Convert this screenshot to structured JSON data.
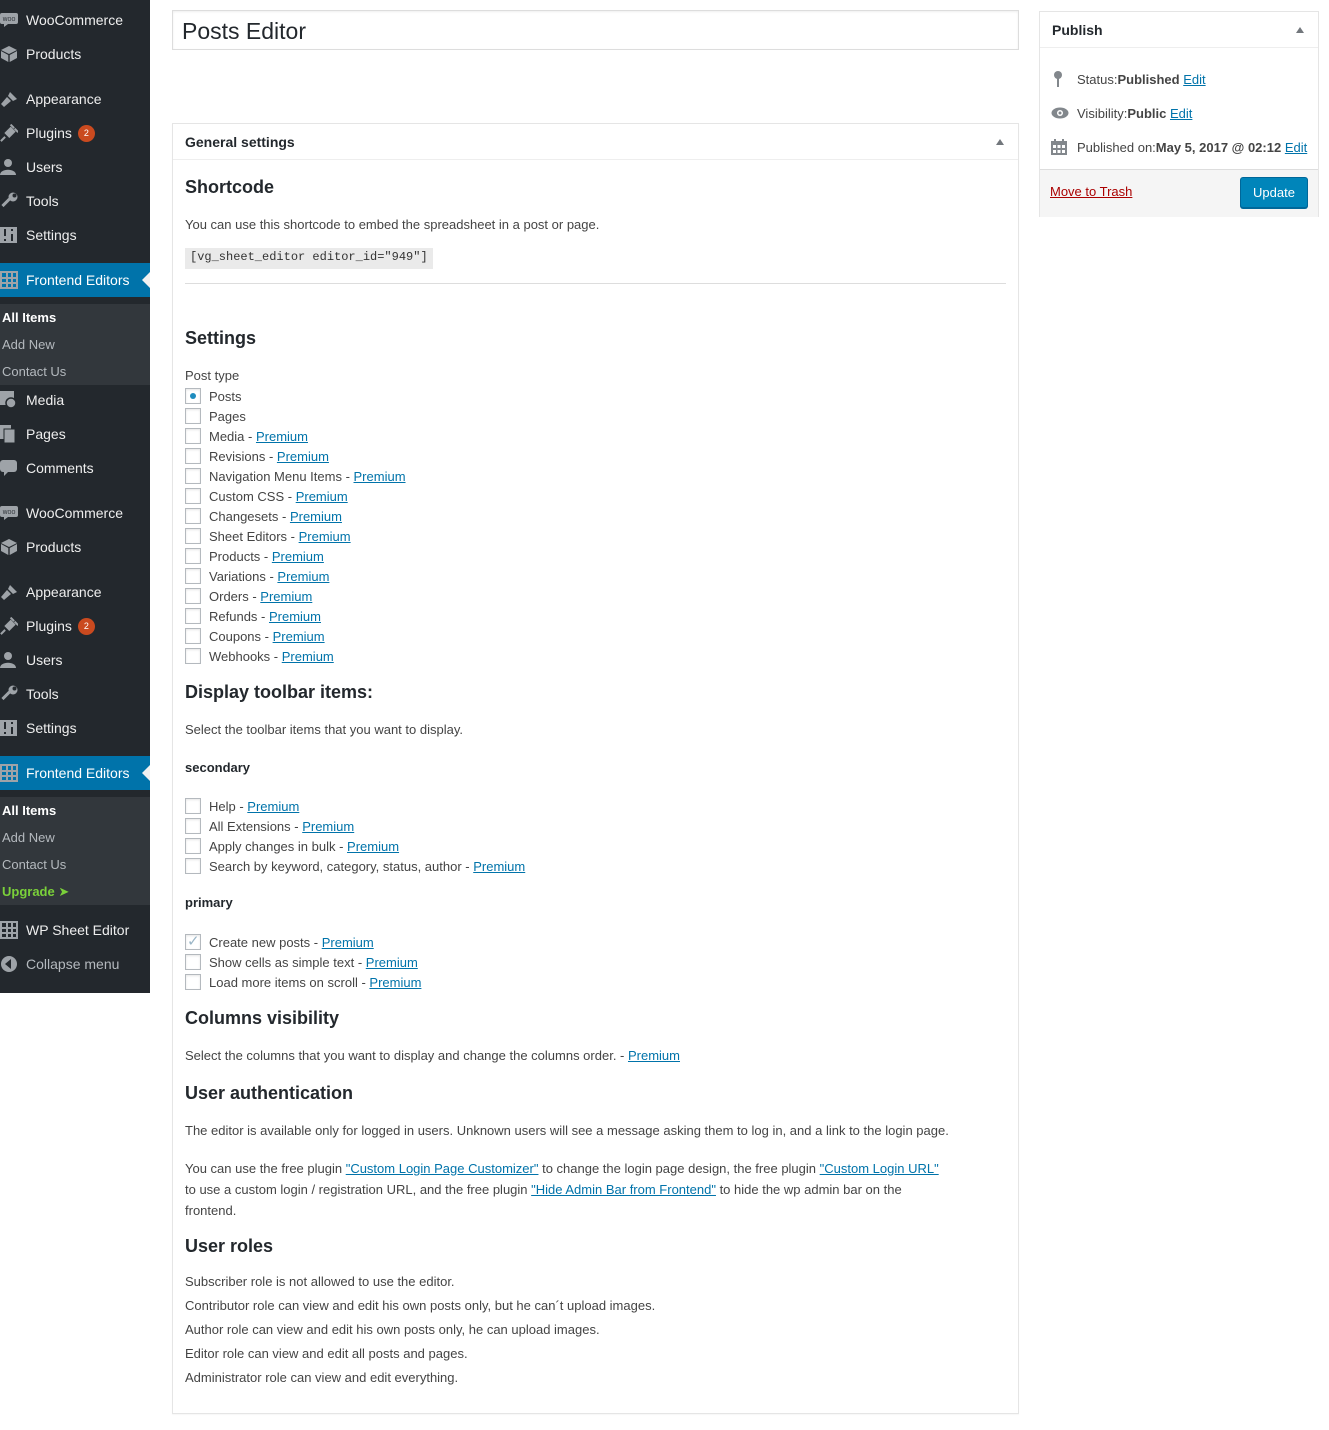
{
  "sidebar": {
    "group1": [
      {
        "label": "WooCommerce",
        "icon": "woo-icon"
      },
      {
        "label": "Products",
        "icon": "box-icon"
      },
      {
        "label": "Appearance",
        "icon": "paintbrush-icon"
      },
      {
        "label": "Plugins",
        "icon": "plugin-icon",
        "badge": "2"
      },
      {
        "label": "Users",
        "icon": "user-icon"
      },
      {
        "label": "Tools",
        "icon": "wrench-icon"
      },
      {
        "label": "Settings",
        "icon": "settings-icon"
      },
      {
        "label": "Frontend Editors",
        "icon": "grid-icon"
      }
    ],
    "submenu1": [
      "All Items",
      "Add New",
      "Contact Us"
    ],
    "group2": [
      {
        "label": "Media",
        "icon": "media-icon"
      },
      {
        "label": "Pages",
        "icon": "pages-icon"
      },
      {
        "label": "Comments",
        "icon": "comment-icon"
      },
      {
        "label": "WooCommerce",
        "icon": "woo-icon"
      },
      {
        "label": "Products",
        "icon": "box-icon"
      },
      {
        "label": "Appearance",
        "icon": "paintbrush-icon"
      },
      {
        "label": "Plugins",
        "icon": "plugin-icon",
        "badge": "2"
      },
      {
        "label": "Users",
        "icon": "user-icon"
      },
      {
        "label": "Tools",
        "icon": "wrench-icon"
      },
      {
        "label": "Settings",
        "icon": "settings-icon"
      },
      {
        "label": "Frontend Editors",
        "icon": "grid-icon"
      }
    ],
    "submenu2": [
      "All Items",
      "Add New",
      "Contact Us",
      "Upgrade ➤"
    ],
    "group3": [
      {
        "label": "WP Sheet Editor",
        "icon": "grid-icon"
      },
      {
        "label": "Collapse menu",
        "icon": "collapse-icon"
      }
    ]
  },
  "title": "Posts Editor",
  "general": {
    "header": "General settings",
    "shortcode_title": "Shortcode",
    "shortcode_desc": "You can use this shortcode to embed the spreadsheet in a post or page.",
    "shortcode_code": "[vg_sheet_editor editor_id=\"949\"]",
    "settings_title": "Settings",
    "post_type_label": "Post type",
    "post_types": [
      {
        "label": "Posts",
        "premium": ""
      },
      {
        "label": "Pages",
        "premium": ""
      },
      {
        "label": "Media - ",
        "premium": "Premium"
      },
      {
        "label": "Revisions - ",
        "premium": "Premium"
      },
      {
        "label": "Navigation Menu Items - ",
        "premium": "Premium"
      },
      {
        "label": "Custom CSS - ",
        "premium": "Premium"
      },
      {
        "label": "Changesets - ",
        "premium": "Premium"
      },
      {
        "label": "Sheet Editors - ",
        "premium": "Premium"
      },
      {
        "label": "Products - ",
        "premium": "Premium"
      },
      {
        "label": "Variations - ",
        "premium": "Premium"
      },
      {
        "label": "Orders - ",
        "premium": "Premium"
      },
      {
        "label": "Refunds - ",
        "premium": "Premium"
      },
      {
        "label": "Coupons - ",
        "premium": "Premium"
      },
      {
        "label": "Webhooks - ",
        "premium": "Premium"
      }
    ],
    "toolbar_title": "Display toolbar items:",
    "toolbar_desc": "Select the toolbar items that you want to display.",
    "secondary_label": "secondary",
    "secondary_items": [
      {
        "label": "Help - ",
        "premium": "Premium"
      },
      {
        "label": "All Extensions - ",
        "premium": "Premium"
      },
      {
        "label": "Apply changes in bulk - ",
        "premium": "Premium"
      },
      {
        "label": "Search by keyword, category, status, author - ",
        "premium": "Premium"
      }
    ],
    "primary_label": "primary",
    "primary_items": [
      {
        "label": "Create new posts - ",
        "premium": "Premium",
        "checked": true
      },
      {
        "label": "Show cells as simple text - ",
        "premium": "Premium",
        "checked": false
      },
      {
        "label": "Load more items on scroll - ",
        "premium": "Premium",
        "checked": false
      }
    ],
    "columns_title": "Columns visibility",
    "columns_desc": "Select the columns that you want to display and change the columns order. - ",
    "columns_premium": "Premium",
    "auth_title": "User authentication",
    "auth_p1": "The editor is available only for logged in users. Unknown users will see a message asking them to log in, and a link to the login page.",
    "auth_p2a": "You can use the free plugin ",
    "auth_link1": "\"Custom Login Page Customizer\"",
    "auth_p2b": " to change the login page design, the free plugin ",
    "auth_link2": "\"Custom Login URL\"",
    "auth_p2c": "to use a custom login / registration URL, and the free plugin ",
    "auth_link3": "\"Hide Admin Bar from Frontend\"",
    "auth_p2d": " to hide the wp admin bar on the",
    "auth_p2e": "frontend.",
    "roles_title": "User roles",
    "roles": [
      "Subscriber role is not allowed to use the editor.",
      "Contributor role can view and edit his own posts only, but he can´t upload images.",
      "Author role can view and edit his own posts only, he can upload images.",
      "Editor role can view and edit all posts and pages.",
      "Administrator role can view and edit everything."
    ]
  },
  "publish": {
    "header": "Publish",
    "status_label": "Status: ",
    "status_value": "Published",
    "visibility_label": "Visibility: ",
    "visibility_value": "Public",
    "published_label": "Published on: ",
    "published_value": "May 5, 2017 @ 02:12",
    "edit": "Edit",
    "trash": "Move to Trash",
    "update": "Update"
  },
  "colors": {
    "sidebar": "#23282d",
    "accent": "#0073aa",
    "button": "#0085ba",
    "badge": "#ca4a1f"
  }
}
